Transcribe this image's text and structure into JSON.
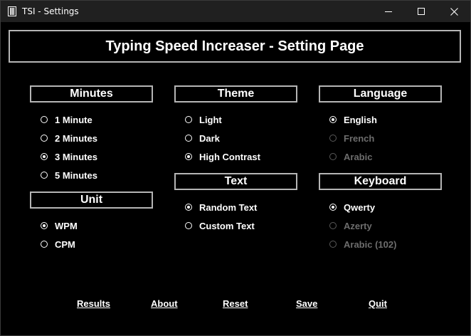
{
  "window": {
    "title": "TSI - Settings"
  },
  "header": {
    "title": "Typing Speed Increaser - Setting Page"
  },
  "groups": {
    "minutes": {
      "title": "Minutes",
      "options": [
        "1 Minute",
        "2 Minutes",
        "3 Minutes",
        "5 Minutes"
      ],
      "selected": "3 Minutes"
    },
    "unit": {
      "title": "Unit",
      "options": [
        "WPM",
        "CPM"
      ],
      "selected": "WPM"
    },
    "theme": {
      "title": "Theme",
      "options": [
        "Light",
        "Dark",
        "High Contrast"
      ],
      "selected": "High Contrast"
    },
    "text": {
      "title": "Text",
      "options": [
        "Random Text",
        "Custom Text"
      ],
      "selected": "Random Text"
    },
    "language": {
      "title": "Language",
      "options": [
        "English",
        "French",
        "Arabic"
      ],
      "selected": "English",
      "disabled": [
        "French",
        "Arabic"
      ]
    },
    "keyboard": {
      "title": "Keyboard",
      "options": [
        "Qwerty",
        "Azerty",
        "Arabic (102)"
      ],
      "selected": "Qwerty",
      "disabled": [
        "Azerty",
        "Arabic (102)"
      ]
    }
  },
  "footer": {
    "results": "Results",
    "about": "About",
    "reset": "Reset",
    "save": "Save",
    "quit": "Quit"
  },
  "colors": {
    "background": "#000000",
    "titlebar": "#202020",
    "border": "#b5b5b5",
    "text": "#ffffff",
    "disabled_text": "#6d6d6d"
  }
}
